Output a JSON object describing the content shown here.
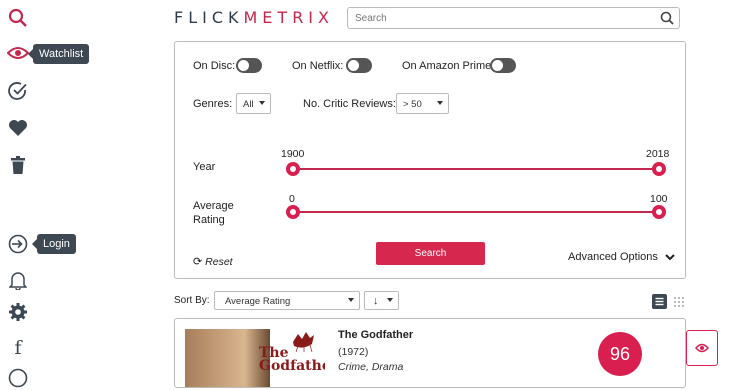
{
  "sidebar": {
    "watchlist_tooltip": "Watchlist",
    "login_tooltip": "Login"
  },
  "header": {
    "logo_part1": "FLICK",
    "logo_part2": "METRIX",
    "search_placeholder": "Search"
  },
  "filters": {
    "on_disc_label": "On Disc:",
    "on_netflix_label": "On Netflix:",
    "on_amazon_label": "On Amazon Prime:",
    "genres_label": "Genres:",
    "genres_value": "All",
    "critic_reviews_label": "No. Critic Reviews:",
    "critic_reviews_value": "> 50",
    "year_label": "Year",
    "year_min": "1900",
    "year_max": "2018",
    "rating_label_line1": "Average",
    "rating_label_line2": "Rating",
    "rating_min": "0",
    "rating_max": "100",
    "search_button": "Search",
    "reset_label": "Reset",
    "advanced_label": "Advanced Options"
  },
  "sort": {
    "label": "Sort By:",
    "field_value": "Average Rating",
    "direction_value": "↓"
  },
  "results": [
    {
      "title": "The Godfather",
      "year": "(1972)",
      "genres": "Crime, Drama",
      "score": "96",
      "poster_text": "The Godfather"
    }
  ],
  "colors": {
    "accent": "#d81f4f",
    "dark": "#2f3d4a"
  }
}
